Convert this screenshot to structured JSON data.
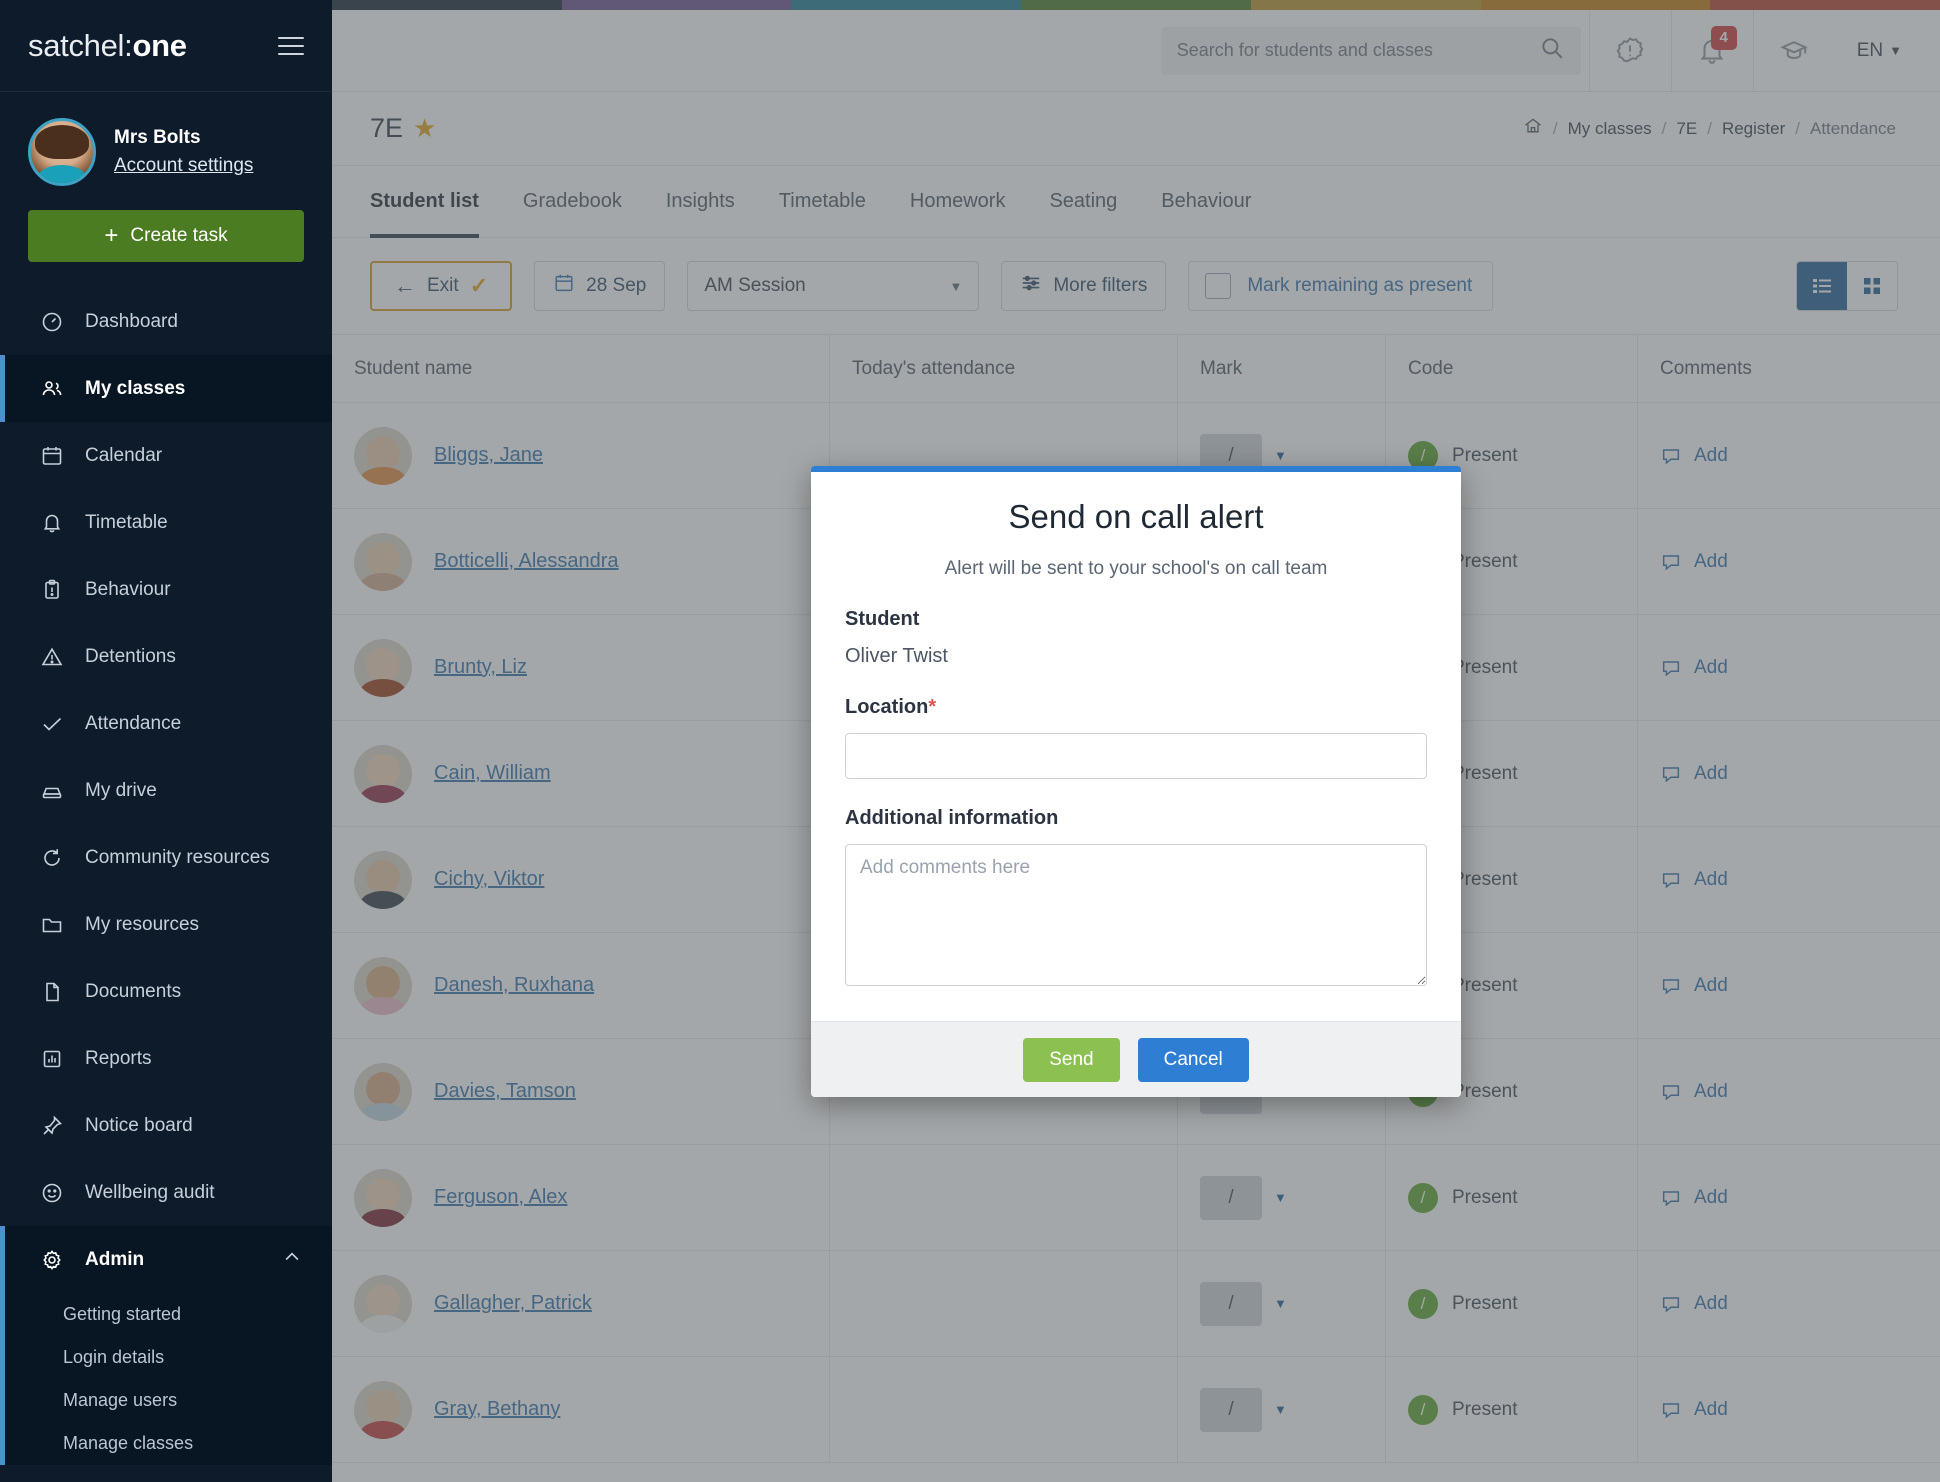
{
  "brand": {
    "prefix": "satchel",
    "colon": ":",
    "suffix": "one"
  },
  "profile": {
    "name": "Mrs Bolts",
    "account_link": "Account settings"
  },
  "create_task_label": "Create task",
  "sidebar": {
    "items": [
      {
        "label": "Dashboard",
        "icon": "gauge-icon",
        "active": false
      },
      {
        "label": "My classes",
        "icon": "people-icon",
        "active": true
      },
      {
        "label": "Calendar",
        "icon": "calendar-icon",
        "active": false
      },
      {
        "label": "Timetable",
        "icon": "bell-icon",
        "active": false
      },
      {
        "label": "Behaviour",
        "icon": "clipboard-icon",
        "active": false
      },
      {
        "label": "Detentions",
        "icon": "warning-icon",
        "active": false
      },
      {
        "label": "Attendance",
        "icon": "check-icon",
        "active": false
      },
      {
        "label": "My drive",
        "icon": "drive-icon",
        "active": false
      },
      {
        "label": "Community resources",
        "icon": "refresh-icon",
        "active": false
      },
      {
        "label": "My resources",
        "icon": "folder-icon",
        "active": false
      },
      {
        "label": "Documents",
        "icon": "document-icon",
        "active": false
      },
      {
        "label": "Reports",
        "icon": "chart-icon",
        "active": false
      },
      {
        "label": "Notice board",
        "icon": "pin-icon",
        "active": false
      },
      {
        "label": "Wellbeing audit",
        "icon": "smiley-icon",
        "active": false
      }
    ],
    "admin": {
      "label": "Admin",
      "expanded": true
    },
    "admin_items": [
      {
        "label": "Getting started"
      },
      {
        "label": "Login details"
      },
      {
        "label": "Manage users"
      },
      {
        "label": "Manage classes"
      }
    ]
  },
  "topbar": {
    "search_placeholder": "Search for students and classes",
    "search_value": "",
    "notifications_count": "4",
    "language": "EN"
  },
  "page": {
    "title": "7E",
    "favourite_star": "★",
    "breadcrumbs": [
      "My classes",
      "7E",
      "Register",
      "Attendance"
    ]
  },
  "tabs": [
    {
      "label": "Student list",
      "active": true
    },
    {
      "label": "Gradebook",
      "active": false
    },
    {
      "label": "Insights",
      "active": false
    },
    {
      "label": "Timetable",
      "active": false
    },
    {
      "label": "Homework",
      "active": false
    },
    {
      "label": "Seating",
      "active": false
    },
    {
      "label": "Behaviour",
      "active": false
    }
  ],
  "toolbar": {
    "exit_label": "Exit",
    "exit_tick": "✓",
    "date_label": "28 Sep",
    "session_value": "AM Session",
    "more_filters_label": "More filters",
    "mark_remaining_label": "Mark remaining as present",
    "mark_remaining_checked": false,
    "view_list_active": true
  },
  "table": {
    "headers": [
      "Student name",
      "Today's attendance",
      "Mark",
      "Code",
      "Comments"
    ],
    "rows": [
      {
        "name": "Bliggs, Jane",
        "attendance": "",
        "mark": "/",
        "code": "Present",
        "comment": "Add",
        "hair": "#6b4a2f",
        "skin": "#e8c9a9",
        "shirt": "#e08a3c"
      },
      {
        "name": "Botticelli, Alessandra",
        "attendance": "",
        "mark": "/",
        "code": "Present",
        "comment": "Add",
        "hair": "#c9a96a",
        "skin": "#eccfb0",
        "shirt": "#cfa98a"
      },
      {
        "name": "Brunty, Liz",
        "attendance": "",
        "mark": "/",
        "code": "Present",
        "comment": "Add",
        "hair": "#c4551f",
        "skin": "#f0d3b8",
        "shirt": "#9b3d1a"
      },
      {
        "name": "Cain, William",
        "attendance": "",
        "mark": "/",
        "code": "Present",
        "comment": "Add",
        "hair": "#cbb089",
        "skin": "#f1d6bb",
        "shirt": "#8e2945"
      },
      {
        "name": "Cichy, Viktor",
        "attendance": "",
        "mark": "/",
        "code": "Present",
        "comment": "Add",
        "hair": "#8a7a63",
        "skin": "#e6c5a3",
        "shirt": "#2f3a45"
      },
      {
        "name": "Danesh, Ruxhana",
        "attendance": "",
        "mark": "/",
        "code": "Present",
        "comment": "Add",
        "hair": "#1c2a4a",
        "skin": "#d9ab7e",
        "shirt": "#e9b9c8"
      },
      {
        "name": "Davies, Tamson",
        "attendance": "",
        "mark": "/",
        "code": "Present",
        "comment": "Add",
        "hair": "#2a1d16",
        "skin": "#d6a882",
        "shirt": "#bcd3e0"
      },
      {
        "name": "Ferguson, Alex",
        "attendance": "",
        "mark": "/",
        "code": "Present",
        "comment": "Add",
        "hair": "#b59a6a",
        "skin": "#efd2b5",
        "shirt": "#7a2030"
      },
      {
        "name": "Gallagher, Patrick",
        "attendance": "",
        "mark": "/",
        "code": "Present",
        "comment": "Add",
        "hair": "#a08a5e",
        "skin": "#f0d7bd",
        "shirt": "#f2f2f0"
      },
      {
        "name": "Gray, Bethany",
        "attendance": "",
        "mark": "/",
        "code": "Present",
        "comment": "Add",
        "hair": "#8a5a2f",
        "skin": "#eccdae",
        "shirt": "#c23b3b"
      }
    ]
  },
  "modal": {
    "title": "Send on call alert",
    "subtitle": "Alert will be sent to your school's on call team",
    "student_label": "Student",
    "student_name": "Oliver Twist",
    "location_label": "Location",
    "location_required": "*",
    "location_value": "",
    "location_placeholder": "",
    "additional_label": "Additional information",
    "additional_value": "",
    "additional_placeholder": "Add comments here",
    "send_label": "Send",
    "cancel_label": "Cancel"
  },
  "colors": {
    "sidebar_bg": "#0d1b2b",
    "accent_blue": "#2e7fd4",
    "send_green": "#8cc152",
    "create_green": "#4c7c22",
    "star_gold": "#e3a21a",
    "badge_red": "#cf3b3b",
    "present_green": "#5ba52d",
    "rainbow": [
      "#152534",
      "#6b4f8f",
      "#1d7a93",
      "#4a7b26",
      "#b8922b",
      "#c07a10",
      "#b8402e"
    ]
  }
}
